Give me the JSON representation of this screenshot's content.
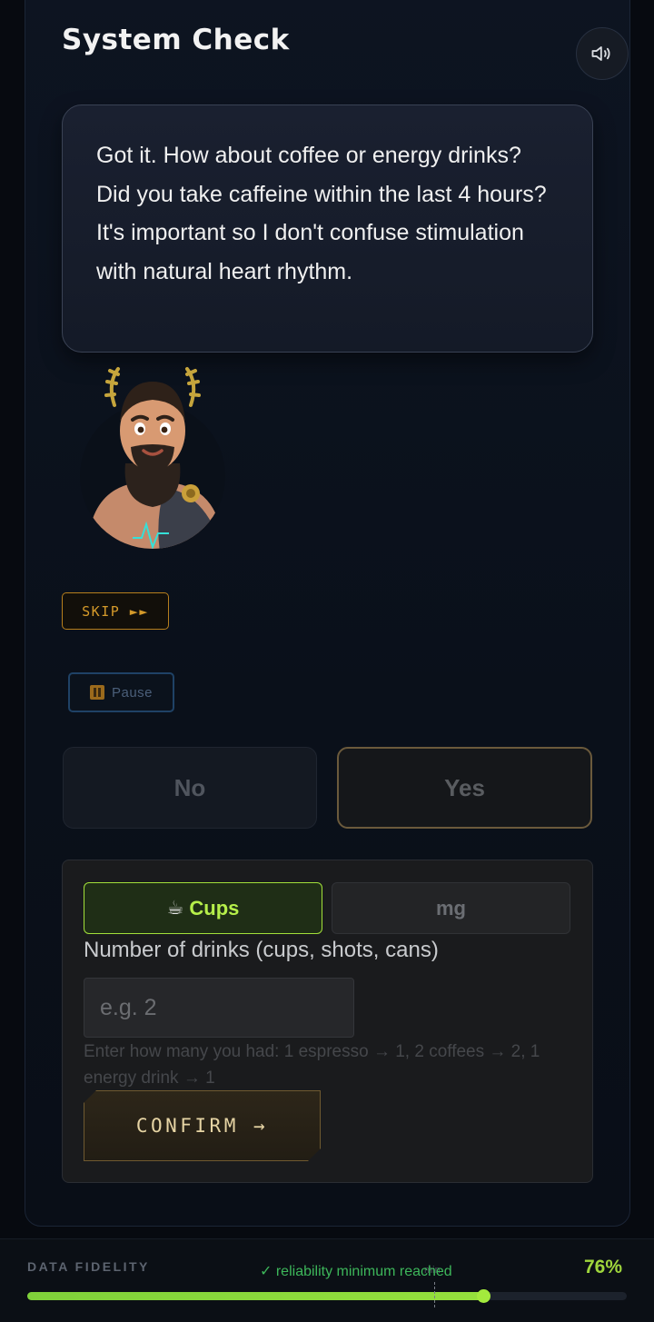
{
  "header": {
    "title": "System Check",
    "sound_icon": "speaker-icon"
  },
  "assistant": {
    "message": "Got it. How about coffee or energy drinks? Did you take caffeine within the last 4 hours? It's important so I don't confuse stimulation with natural heart rhythm.",
    "avatar": "laurel-crowned-bearded-guide"
  },
  "controls": {
    "skip_label": "SKIP ►►",
    "pause_label": "Pause"
  },
  "answers": {
    "no_label": "No",
    "yes_label": "Yes"
  },
  "caffeine_form": {
    "unit_tabs": [
      {
        "icon": "☕",
        "label": "Cups",
        "selected": true
      },
      {
        "label": "mg",
        "selected": false
      }
    ],
    "field_label": "Number of drinks (cups, shots, cans)",
    "input_value": "",
    "input_placeholder": "e.g. 2",
    "hint": "Enter how many you had: 1 espresso → 1, 2 coffees → 2, 1 energy drink → 1",
    "confirm_label": "CONFIRM →"
  },
  "footer": {
    "label": "DATA FIDELITY",
    "status": "✓ reliability minimum reached",
    "min_marker_label": "min",
    "percent_text": "76%",
    "progress_fraction": 0.76,
    "minimum_fraction": 0.68
  },
  "colors": {
    "accent_green": "#9fd63c",
    "accent_gold": "#d59a2a",
    "background": "#070a10"
  }
}
